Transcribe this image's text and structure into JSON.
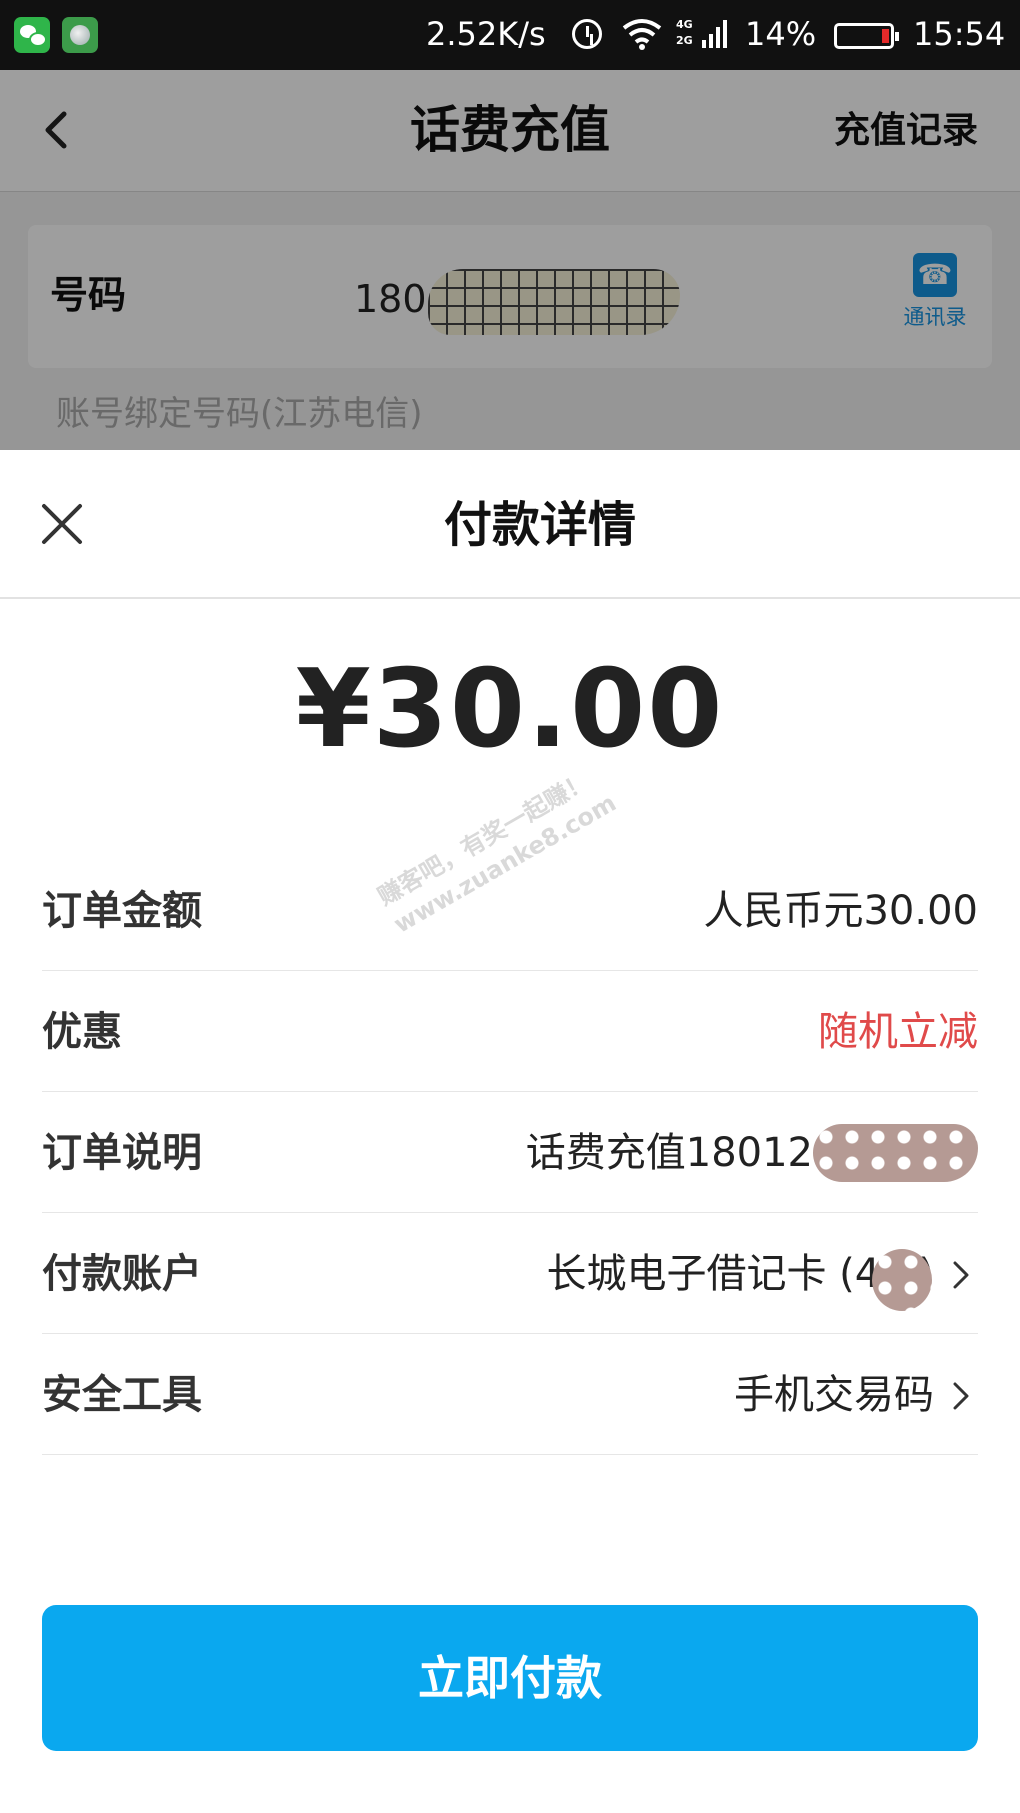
{
  "status_bar": {
    "speed": "2.52K/s",
    "network": [
      "4G",
      "2G"
    ],
    "battery_percent": "14%",
    "time": "15:54",
    "battery_level": 0.14,
    "icons": [
      "wechat-icon",
      "app-icon",
      "alarm-icon",
      "wifi-icon",
      "signal-icon",
      "battery-icon"
    ]
  },
  "nav": {
    "title": "话费充值",
    "right_link": "充值记录"
  },
  "phone_card": {
    "label": "号码",
    "number_visible": "180 1279",
    "contacts_label": "通讯录"
  },
  "bound_note": "账号绑定号码(江苏电信)",
  "sheet": {
    "title": "付款详情",
    "amount": "¥30.00",
    "rows": [
      {
        "label": "订单金额",
        "value": "人民币元30.00"
      },
      {
        "label": "优惠",
        "value": "随机立减"
      },
      {
        "label": "订单说明",
        "value": "话费充值18012"
      },
      {
        "label": "付款账户",
        "value": "长城电子借记卡 (47 )"
      },
      {
        "label": "安全工具",
        "value": "手机交易码"
      }
    ],
    "pay_button": "立即付款"
  },
  "watermark": {
    "line1": "赚客吧，有奖一起赚！",
    "line2": "www.zuanke8.com"
  },
  "colors": {
    "accent_blue": "#0aa8ef",
    "discount_red": "#e04a4a",
    "contacts_blue": "#1793e0"
  }
}
